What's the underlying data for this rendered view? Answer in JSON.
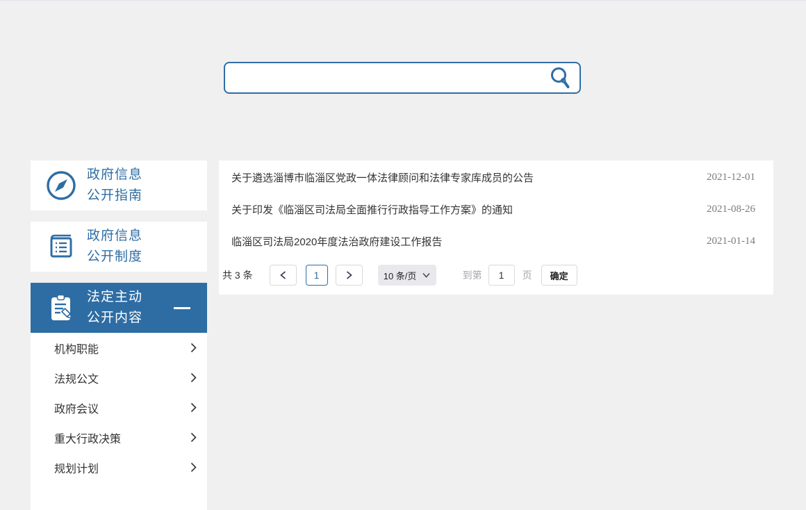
{
  "theme": {
    "accent": "#2e6da4",
    "page_bg": "#f0f0f0",
    "panel_bg": "#ffffff",
    "date_gray": "#7b7b80",
    "select_bg": "#e9e9ed"
  },
  "search": {
    "value": "",
    "icon": "search-icon"
  },
  "sidebar": {
    "items": [
      {
        "line1": "政府信息",
        "line2": "公开指南",
        "icon": "compass-icon",
        "active": false
      },
      {
        "line1": "政府信息",
        "line2": "公开制度",
        "icon": "ledger-icon",
        "active": false
      },
      {
        "line1": "法定主动",
        "line2": "公开内容",
        "icon": "clipboard-pen-icon",
        "active": true,
        "collapse_icon": "minus-icon"
      }
    ],
    "submenu": [
      {
        "label": "机构职能",
        "icon": "chevron-right-icon"
      },
      {
        "label": "法规公文",
        "icon": "chevron-right-icon"
      },
      {
        "label": "政府会议",
        "icon": "chevron-right-icon"
      },
      {
        "label": "重大行政决策",
        "icon": "chevron-right-icon"
      },
      {
        "label": "规划计划",
        "icon": "chevron-right-icon"
      }
    ]
  },
  "main": {
    "list": [
      {
        "title": "关于遴选淄博市临淄区党政一体法律顾问和法律专家库成员的公告",
        "date": "2021-12-01"
      },
      {
        "title": "关于印发《临淄区司法局全面推行行政指导工作方案》的通知",
        "date": "2021-08-26"
      },
      {
        "title": "临淄区司法局2020年度法治政府建设工作报告",
        "date": "2021-01-14"
      }
    ],
    "pagination": {
      "total_label": "共 3 条",
      "prev_icon": "chevron-left-icon",
      "current_page": "1",
      "next_icon": "chevron-right-icon",
      "page_size_label": "10 条/页",
      "page_size_caret": "chevron-down-icon",
      "goto_prefix": "到第",
      "goto_value": "1",
      "goto_suffix": "页",
      "confirm_label": "确定"
    }
  }
}
